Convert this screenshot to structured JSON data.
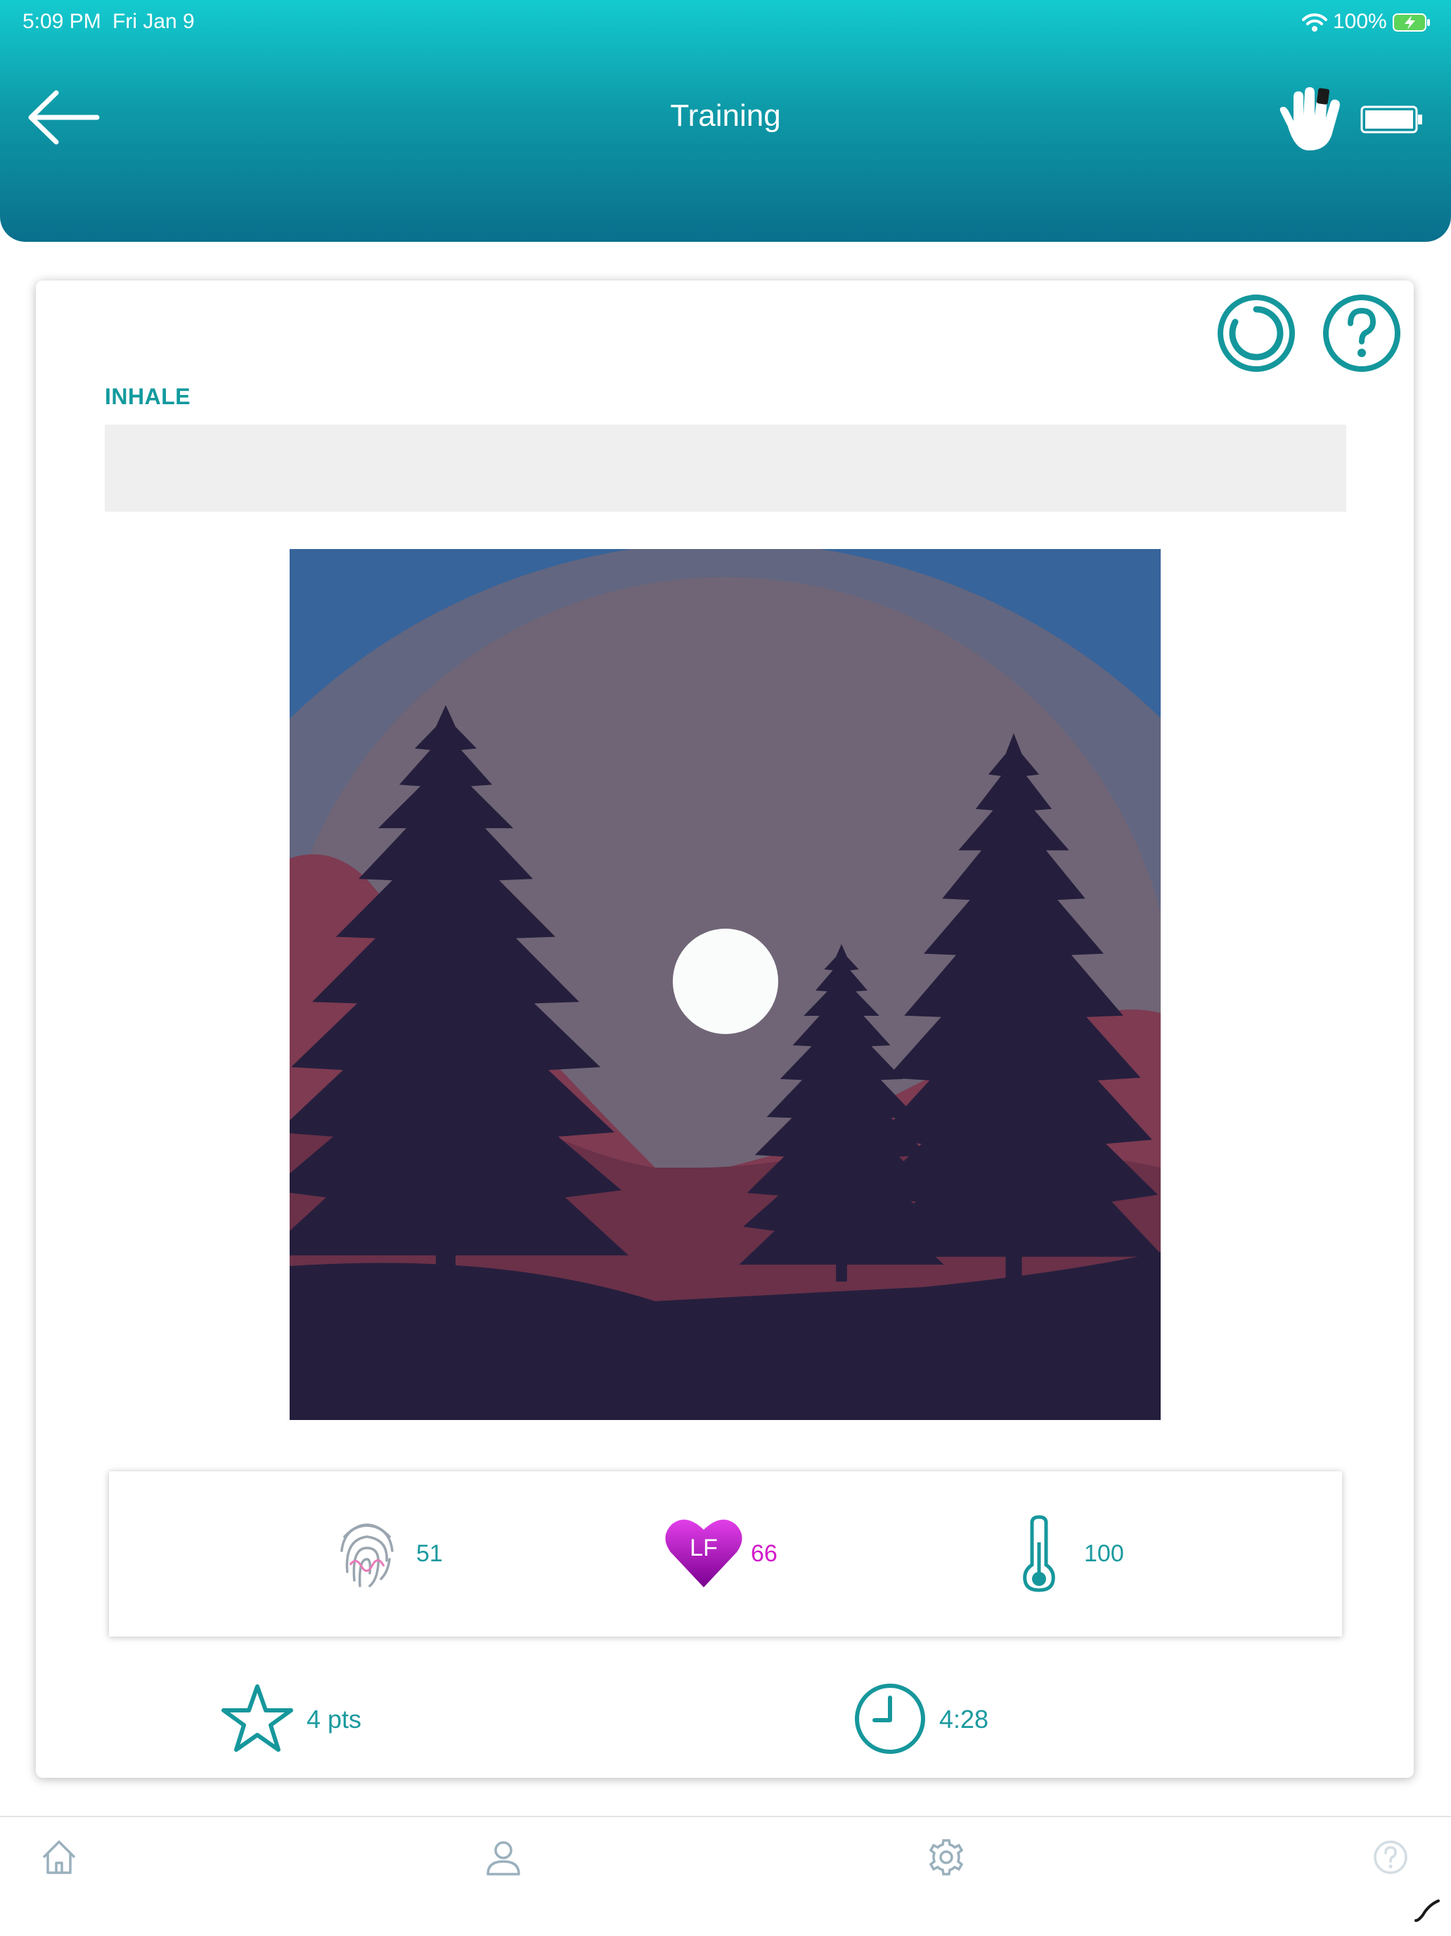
{
  "status_bar": {
    "time": "5:09 PM",
    "date": "Fri Jan 9",
    "battery": "100%"
  },
  "header": {
    "title": "Training"
  },
  "breathing": {
    "phase_label": "INHALE",
    "progress": 0
  },
  "metrics": {
    "hrv_value": "51",
    "hr_badge": "LF",
    "hr_value": "66",
    "temperature_value": "100"
  },
  "session": {
    "points": "4 pts",
    "time_elapsed": "4:28"
  },
  "tabbar": {
    "items": [
      "home",
      "profile",
      "settings",
      "help"
    ]
  },
  "colors": {
    "accent": "#1a9a9f",
    "header_top": "#14cbd0",
    "header_bottom": "#0a6f8c",
    "heart": "#b000c8"
  }
}
